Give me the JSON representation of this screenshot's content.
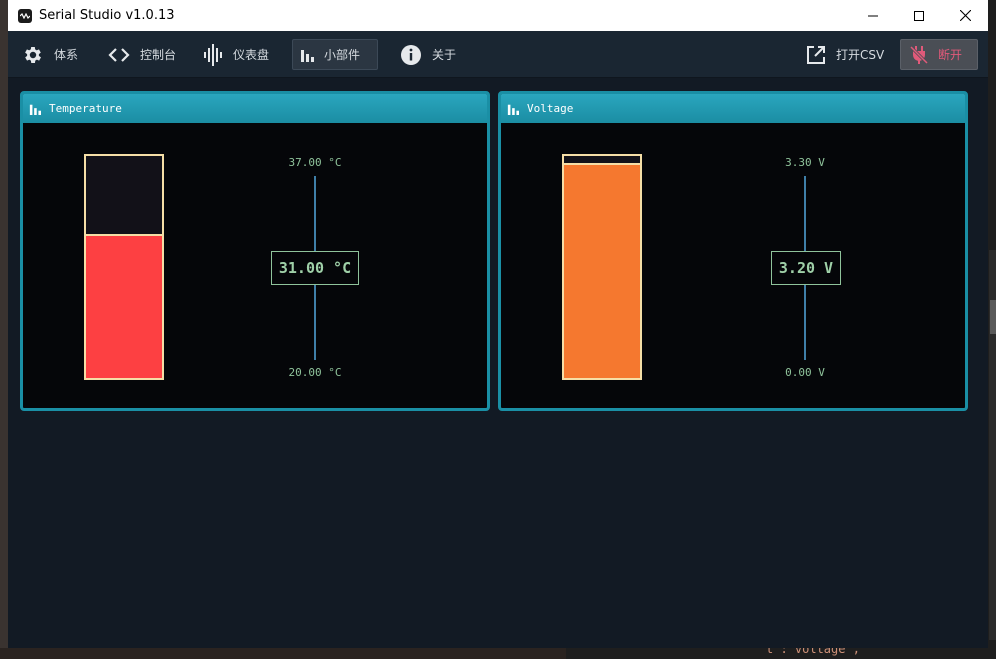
{
  "window": {
    "title": "Serial Studio v1.0.13"
  },
  "toolbar": {
    "items": [
      {
        "label": "体系",
        "icon": "gear-icon"
      },
      {
        "label": "控制台",
        "icon": "code-icon"
      },
      {
        "label": "仪表盘",
        "icon": "waveform-icon"
      },
      {
        "label": "小部件",
        "icon": "bar-chart-icon",
        "active": true
      },
      {
        "label": "关于",
        "icon": "info-icon"
      }
    ],
    "open_csv_label": "打开CSV",
    "disconnect_label": "断开"
  },
  "widgets": [
    {
      "title": "Temperature",
      "icon": "bar-chart-icon",
      "max_label": "37.00 °C",
      "min_label": "20.00 °C",
      "value_label": "31.00 °C",
      "min": 20,
      "max": 37,
      "value": 31,
      "fill_color": "#fd4042"
    },
    {
      "title": "Voltage",
      "icon": "bar-chart-icon",
      "max_label": "3.30 V",
      "min_label": "0.00 V",
      "value_label": "3.20 V",
      "min": 0,
      "max": 3.3,
      "value": 3.2,
      "fill_color": "#f5782f"
    }
  ],
  "background_editor": {
    "snippet": "t\": voltage\","
  },
  "colors": {
    "accent": "#1a8fa5",
    "window_bg": "#121a24",
    "toolbar_bg": "#1a2632",
    "disconnect_text": "#e05a7a",
    "value_text": "#9fd0a8"
  }
}
